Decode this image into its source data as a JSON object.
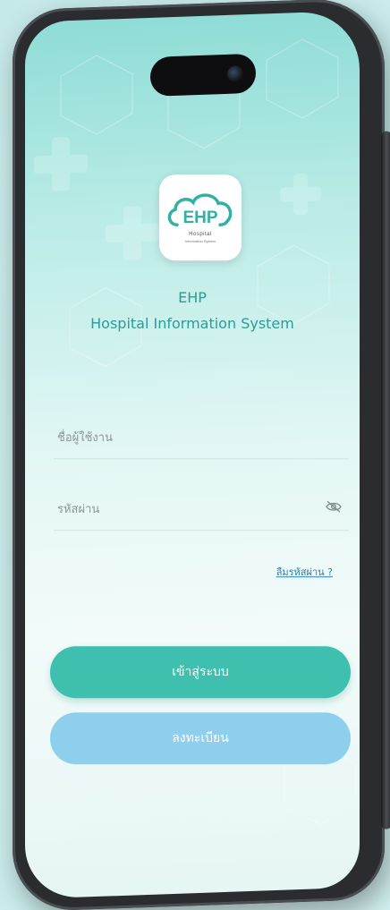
{
  "app": {
    "logo_text": "EHP",
    "logo_sub1": "Hospital",
    "logo_sub2": "Information System",
    "title": "EHP",
    "subtitle": "Hospital Information System"
  },
  "login_form": {
    "username_placeholder": "ชื่อผู้ใช้งาน",
    "password_placeholder": "รหัสผ่าน",
    "forgot_password": "ลืมรหัสผ่าน ?",
    "login_button": "เข้าสู่ระบบ",
    "register_button": "ลงทะเบียน"
  },
  "icons": {
    "password_toggle": "eye-off-icon",
    "logo": "cloud-icon"
  },
  "colors": {
    "brand": "#2a9d95",
    "primary_button": "#3fbfad",
    "secondary_button": "#8fcfee",
    "link": "#2d7fb3"
  }
}
